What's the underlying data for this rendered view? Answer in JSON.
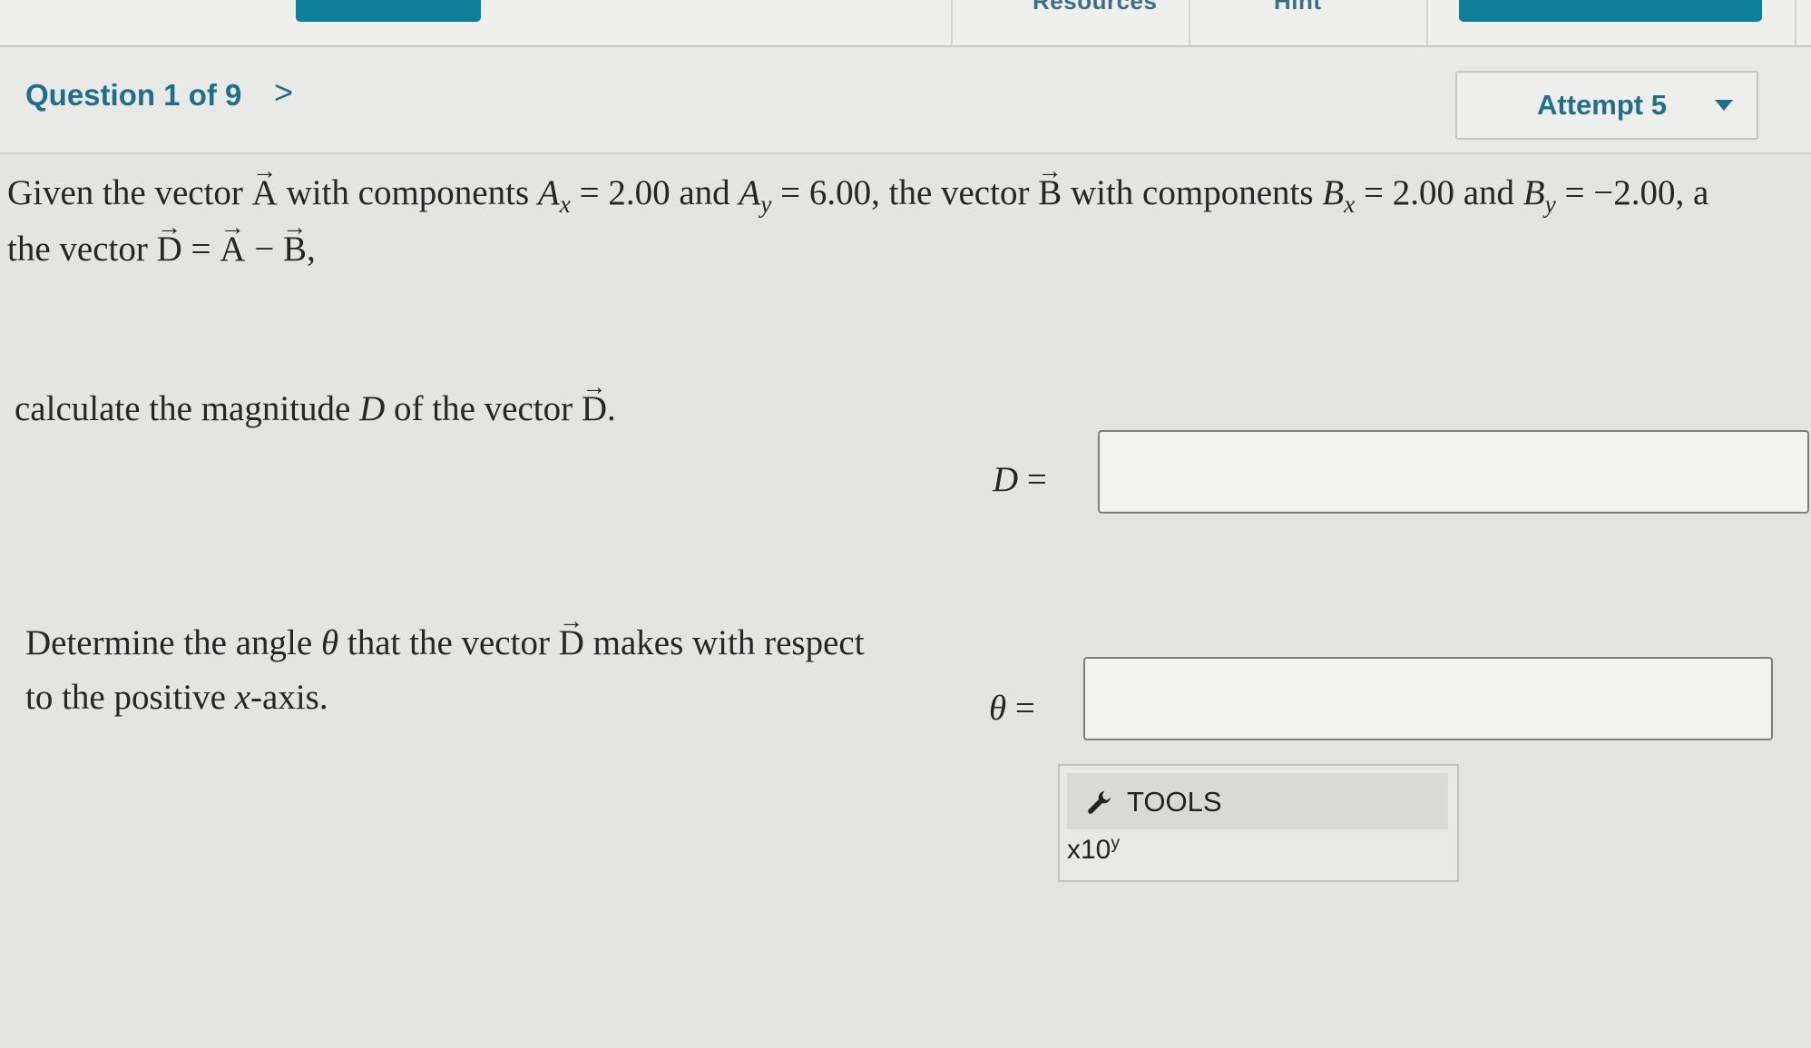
{
  "top_nav": {
    "tabs": [
      "Resources",
      "Hint"
    ]
  },
  "question_header": {
    "title": "Question 1 of 9",
    "next_symbol": ">",
    "attempt_label": "Attempt 5"
  },
  "problem": {
    "intro": {
      "t1": "Given the vector ",
      "A": "A",
      "t2": " with components ",
      "Ax_var": "A",
      "Ax_sub": "x",
      "t3": " = 2.00 and ",
      "Ay_var": "A",
      "Ay_sub": "y",
      "t4": " = 6.00, the vector ",
      "B": "B",
      "t5": " with components ",
      "Bx_var": "B",
      "Bx_sub": "x",
      "t6": " = 2.00 and ",
      "By_var": "B",
      "By_sub": "y",
      "t7": " = −2.00, a"
    },
    "intro_line2": {
      "t1": "the vector ",
      "D": "D",
      "t2": " = ",
      "A": "A",
      "t3": " − ",
      "B": "B",
      "t4": ","
    },
    "part1": {
      "t1": "calculate the magnitude ",
      "D_var": "D",
      "t2": " of the vector ",
      "D_vec": "D",
      "t3": "."
    },
    "part1_label": {
      "var": "D",
      "eq": " ="
    },
    "part2_line1": {
      "t1": "Determine the angle ",
      "theta": "θ",
      "t2": " that the vector ",
      "D_vec": "D",
      "t3": " makes with respect"
    },
    "part2_line2": {
      "t1": "to the positive ",
      "x": "x",
      "t2": "-axis."
    },
    "part2_label": {
      "var": "θ",
      "eq": " ="
    }
  },
  "tools": {
    "label": "TOOLS",
    "sci_base": "x10",
    "sci_exp": "y"
  }
}
